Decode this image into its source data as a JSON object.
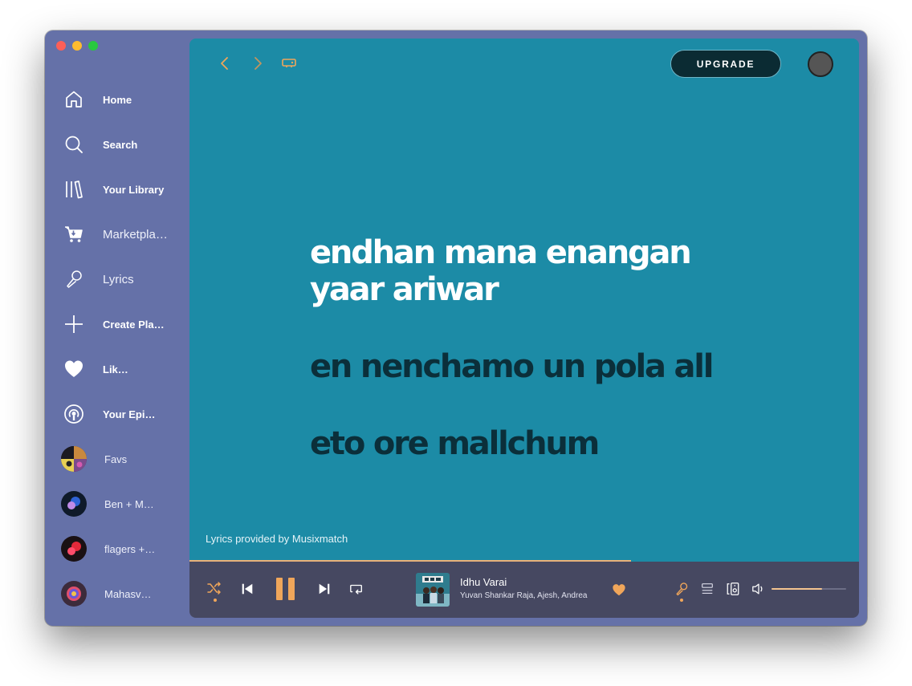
{
  "window": {
    "traffic_lights": [
      "close",
      "minimize",
      "zoom"
    ]
  },
  "sidebar": {
    "items": [
      {
        "label": "Home",
        "icon": "home-icon"
      },
      {
        "label": "Search",
        "icon": "search-icon"
      },
      {
        "label": "Your Library",
        "icon": "library-icon"
      },
      {
        "label": "Marketpla…",
        "icon": "cart-icon"
      },
      {
        "label": "Lyrics",
        "icon": "microphone-icon"
      },
      {
        "label": "Create Pla…",
        "icon": "plus-icon"
      },
      {
        "label": "Lik…",
        "icon": "heart-icon",
        "playing": true
      },
      {
        "label": "Your Epi…",
        "icon": "podcast-icon"
      }
    ],
    "playlists": [
      {
        "label": "Favs"
      },
      {
        "label": "Ben + M…"
      },
      {
        "label": "flagers +…"
      },
      {
        "label": "Mahasv…"
      }
    ]
  },
  "topbar": {
    "upgrade_label": "UPGRADE",
    "icons": [
      "back-icon",
      "forward-icon",
      "device-icon",
      "avatar"
    ]
  },
  "lyrics": {
    "active": [
      "endhan mana enangan",
      "yaar ariwar"
    ],
    "upcoming": [
      "en nenchamo un pola all",
      "eto ore mallchum"
    ],
    "provider": "Lyrics provided by Musixmatch"
  },
  "playback": {
    "progress": 0.66
  },
  "player": {
    "track_title": "Idhu Varai",
    "track_artist": "Yuvan Shankar Raja, Ajesh, Andrea",
    "volume": 0.68,
    "liked": true,
    "shuffle_on": true,
    "lyrics_on": true
  },
  "colors": {
    "sidebar_bg": "#6571a8",
    "lyrics_bg": "#1c8ba6",
    "player_bg": "#464861",
    "accent": "#f0a65a",
    "lyric_active": "#ffffff",
    "lyric_upcoming": "#0b2f3a"
  }
}
